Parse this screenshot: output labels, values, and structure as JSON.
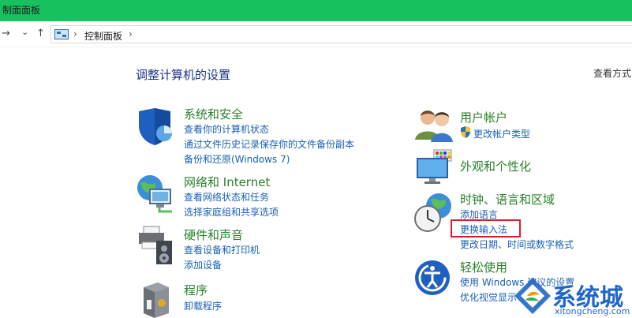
{
  "window": {
    "title": "制面面板"
  },
  "nav": {
    "forward": "→",
    "dropdown": "⌄",
    "up": "↑",
    "separator": "›"
  },
  "address": {
    "path": "控制面板"
  },
  "heading": "调整计算机的设置",
  "view_by": "查看方式",
  "categories": {
    "system_security": {
      "title": "系统和安全",
      "links": [
        "查看你的计算机状态",
        "通过文件历史记录保存你的文件备份副本",
        "备份和还原(Windows 7)"
      ]
    },
    "network": {
      "title": "网络和 Internet",
      "links": [
        "查看网络状态和任务",
        "选择家庭组和共享选项"
      ]
    },
    "hardware": {
      "title": "硬件和声音",
      "links": [
        "查看设备和打印机",
        "添加设备"
      ]
    },
    "programs": {
      "title": "程序",
      "links": [
        "卸载程序"
      ]
    },
    "user_accounts": {
      "title": "用户帐户",
      "links": [
        "更改帐户类型"
      ]
    },
    "appearance": {
      "title": "外观和个性化",
      "links": []
    },
    "clock_language": {
      "title": "时钟、语言和区域",
      "links": [
        "添加语言",
        "更换输入法",
        "更改日期、时间或数字格式"
      ]
    },
    "ease_of_access": {
      "title": "轻松使用",
      "links": [
        "使用 Windows 建议的设置",
        "优化视觉显示"
      ]
    }
  },
  "watermark": {
    "text": "系统城",
    "url": "xitongcheng.com"
  },
  "colors": {
    "titlebar": "#17c25e",
    "link": "#1a5fb4",
    "category_title": "#2a7f2a",
    "highlight": "#d8202a"
  }
}
